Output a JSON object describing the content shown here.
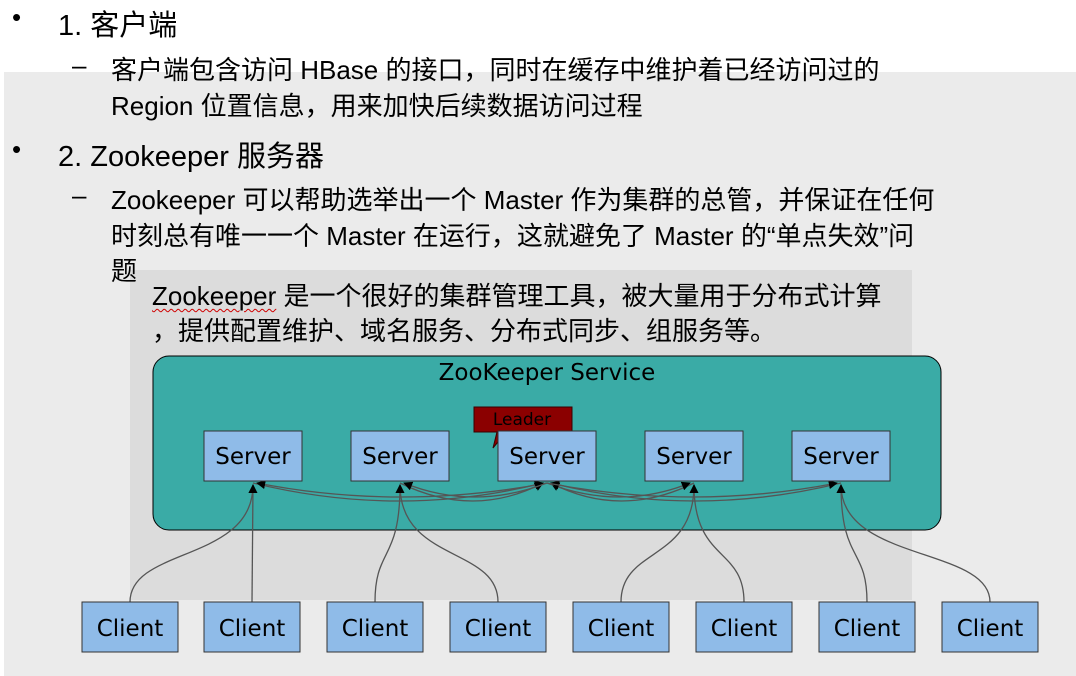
{
  "bullets": [
    {
      "title": "1.  客户端",
      "sub_lines": [
        "客户端包含访问 HBase 的接口，同时在缓存中维护着已经访问过的",
        "Region 位置信息，用来加快后续数据访问过程"
      ]
    },
    {
      "title": "2. Zookeeper 服务器",
      "sub_lines": [
        "Zookeeper 可以帮助选举出一个 Master 作为集群的总管，并保证在任何",
        "时刻总有唯一一个 Master 在运行，这就避免了 Master 的“单点失效”问",
        "题"
      ]
    }
  ],
  "note": {
    "word": "Zookeeper",
    "line1_rest": " 是一个很好的集群管理工具，被大量用于分布式计算",
    "line2": "，提供配置维护、域名服务、分布式同步、组服务等。"
  },
  "diagram": {
    "service_title": "ZooKeeper Service",
    "leader_label": "Leader",
    "servers": [
      "Server",
      "Server",
      "Server",
      "Server",
      "Server"
    ],
    "leader_index": 2,
    "clients": [
      "Client",
      "Client",
      "Client",
      "Client",
      "Client",
      "Client",
      "Client",
      "Client"
    ],
    "colors": {
      "service_fill": "#3aaba6",
      "box_fill": "#8fbbe8",
      "leader_fill": "#8b0000"
    }
  }
}
